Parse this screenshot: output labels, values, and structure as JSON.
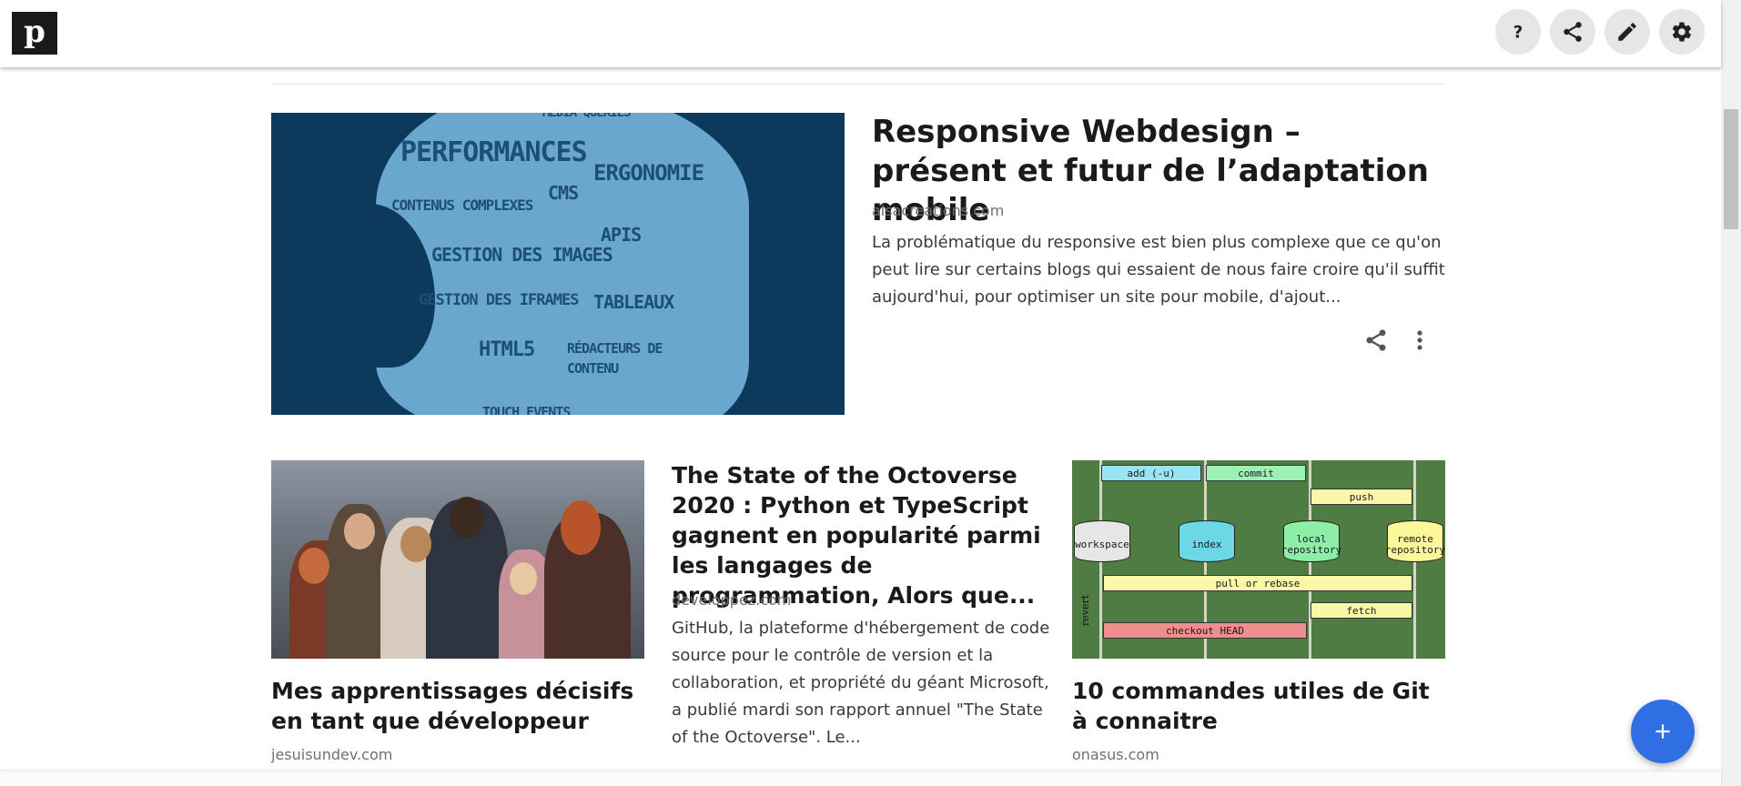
{
  "app": {
    "logo_letter": "p"
  },
  "toolbar": {
    "help_icon": "help-icon",
    "share_icon": "share-icon",
    "edit_icon": "edit-icon",
    "settings_icon": "gear-icon"
  },
  "featured": {
    "title": "Responsive Webdesign – présent et futur de l’adaptation mobile",
    "source": "alsacreations.com",
    "excerpt": "La problématique du responsive est bien plus complexe que ce qu'on peut lire sur certains blogs qui essaient de nous faire croire qu'il suffit aujourd'hui, pour optimiser un site pour mobile, d'ajout...",
    "image_words": [
      "MEDIA QUERIES",
      "PERFORMANCES",
      "ERGONOMIE",
      "CMS",
      "CONTENUS COMPLEXES",
      "APIS",
      "GESTION DES IMAGES",
      "GESTION DES IFRAMES",
      "TABLEAUX",
      "HTML5",
      "RÉDACTEURS DE",
      "CONTENU",
      "TOUCH EVENTS"
    ]
  },
  "cards": [
    {
      "title": "Mes apprentissages décisifs en tant que développeur",
      "source": "jesuisundev.com"
    },
    {
      "title": "The State of the Octoverse 2020 : Python et TypeScript gagnent en popularité parmi les langages de programmation, Alors que...",
      "source": "developpez.com",
      "excerpt": "GitHub, la plateforme d'hébergement de code source pour le contrôle de version et la collaboration, et propriété du géant Microsoft, a publié mardi son rapport annuel \"The State of the Octoverse\". Le..."
    },
    {
      "title": "10 commandes utiles de Git à connaitre",
      "source": "onasus.com",
      "image_labels": {
        "add": "add (-u)",
        "commit": "commit",
        "push": "push",
        "workspace": "workspace",
        "index": "index",
        "local": "local repository",
        "remote": "remote repository",
        "pull": "pull or rebase",
        "fetch": "fetch",
        "checkout": "checkout HEAD",
        "revert": "revert"
      }
    }
  ],
  "fab": {
    "icon": "plus-icon"
  },
  "colors": {
    "accent": "#2f6fe3",
    "logo_bg": "#1a1a1a"
  }
}
